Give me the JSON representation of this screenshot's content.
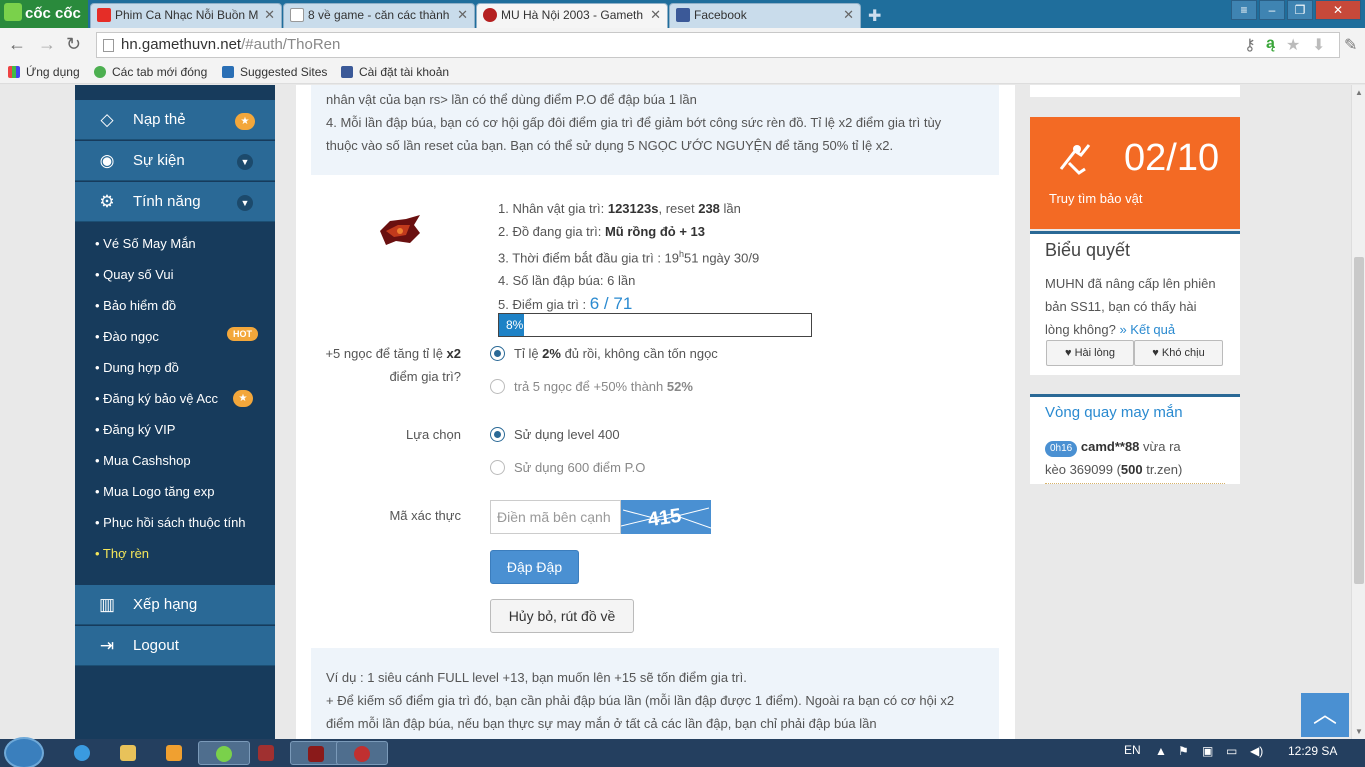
{
  "browser": {
    "brand": "cốc cốc",
    "tabs": [
      {
        "title": "Phim Ca Nhạc Nỗi Buồn M"
      },
      {
        "title": "8 về game - căn các thành"
      },
      {
        "title": "MU Hà Nội 2003 - Gameth"
      },
      {
        "title": "Facebook"
      }
    ],
    "url_host": "hn.gamethuvn.net",
    "url_path": "/#auth/ThoRen",
    "bookmarks": [
      "Ứng dụng",
      "Các tab mới đóng",
      "Suggested Sites",
      "Cài đặt tài khoản"
    ]
  },
  "sidebar": {
    "main_items": [
      {
        "label": "Nạp thẻ",
        "icon": "diamond-icon"
      },
      {
        "label": "Sự kiện",
        "icon": "android-icon"
      },
      {
        "label": "Tính năng",
        "icon": "cogs-icon"
      }
    ],
    "sub_items": [
      "• Vé Số May Mắn",
      "• Quay số Vui",
      "• Bảo hiểm đồ",
      "• Đào ngọc",
      "• Dung hợp đồ",
      "• Đăng ký bảo vệ Acc",
      "• Đăng ký VIP",
      "• Mua Cashshop",
      "• Mua Logo tăng exp",
      "• Phục hồi sách thuộc tính",
      "• Thợ rèn"
    ],
    "hot_badge": "HOT",
    "bottom_items": [
      {
        "label": "Xếp hạng",
        "icon": "bar-chart-icon"
      },
      {
        "label": "Logout",
        "icon": "sign-out-icon"
      }
    ]
  },
  "main": {
    "intro_line1": "nhân vật của bạn rs> lần có thể dùng điểm P.O để đập búa 1 lần",
    "intro_line2": "4. Mỗi lần đập búa, bạn có cơ hội gấp đôi điểm gia trì để giảm bớt công sức rèn đồ. Tỉ lệ x2 điểm gia trì tùy",
    "intro_line3": "thuộc vào số lần reset của bạn. Bạn có thể sử dụng 5 NGỌC ƯỚC NGUYỆN để tăng 50% tỉ lệ x2.",
    "details": {
      "d1_prefix": "1. Nhân vật gia trì: ",
      "d1_name": "123123s",
      "d1_mid": ", reset ",
      "d1_reset": "238",
      "d1_suffix": " lần",
      "d2_prefix": "2. Đồ đang gia trì: ",
      "d2_item": "Mũ rồng đỏ + 13",
      "d3_prefix": "3. Thời điểm bắt đầu gia trì : 19",
      "d3_sup": "h",
      "d3_suffix": "51 ngày 30/9",
      "d4": "4. Số lần đập búa: 6 lần",
      "d5_prefix": "5. Điểm gia trì : ",
      "d5_value": "6 / 71",
      "progress_label": "8%",
      "progress_fraction": 0.08
    },
    "x2_label_a": "+5 ngọc để tăng tỉ lệ ",
    "x2_label_b": "x2",
    "x2_label_c": "điểm gia trì?",
    "x2_opt1_a": "Tỉ lệ ",
    "x2_opt1_b": "2%",
    "x2_opt1_c": " đủ rồi, không cần tốn ngọc",
    "x2_opt2_a": "trả 5 ngọc để +50% thành ",
    "x2_opt2_b": "52%",
    "choice_label": "Lựa chọn",
    "choice_opt1": "Sử dụng level 400",
    "choice_opt2": "Sử dụng 600 điểm P.O",
    "captcha_label": "Mã xác thực",
    "captcha_placeholder": "Điền mã bên cạnh",
    "captcha_code": "415",
    "submit_label": "Đập Đập",
    "cancel_label": "Hủy bỏ, rút đồ về",
    "example_line1": "Ví dụ : 1 siêu cánh FULL level +13, bạn muốn lên +15 sẽ tốn điểm gia trì.",
    "example_line2": "+ Để kiếm số điểm gia trì đó, bạn cần phải đập búa lần (mỗi lần đập được 1 điểm). Ngoài ra bạn có cơ hội x2",
    "example_line3": "điểm mỗi lần đập búa, nếu bạn thực sự may mắn ở tất cả các lần đập, bạn chỉ phải đập búa lần"
  },
  "right": {
    "treasure_count": "02/10",
    "treasure_label": "Truy tìm bảo vật",
    "poll_title": "Biểu quyết",
    "poll_text1": "MUHN đã nâng cấp lên phiên",
    "poll_text2": "bản SS11, bạn có thấy hài",
    "poll_text3": "lòng không?",
    "poll_link": "» Kết quả",
    "poll_like": "Hài lòng",
    "poll_dislike": "Khó chịu",
    "wheel_title": "Vòng quay may mắn",
    "wheel_time": "0h16",
    "wheel_user": "camd**88",
    "wheel_text1": " vừa ra",
    "wheel_text2": "kèo 369099 (",
    "wheel_amount": "500",
    "wheel_text3": " tr.zen)"
  },
  "taskbar": {
    "lang": "EN",
    "clock": "12:29 SA"
  },
  "colors": {
    "sidebar_dark": "#173b5c",
    "sidebar_item": "#2a6996",
    "active_sub": "#f5e65a",
    "orange": "#f36a24",
    "primary": "#4a90d2"
  }
}
